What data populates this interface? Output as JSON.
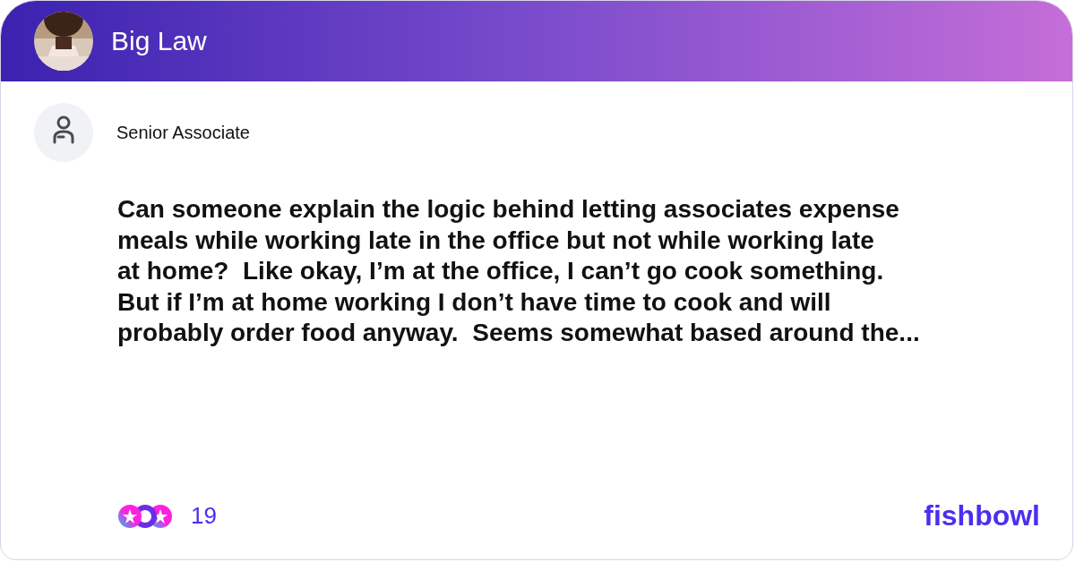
{
  "header": {
    "community": "Big Law"
  },
  "post": {
    "author": "Senior Associate",
    "body": "Can someone explain the logic behind letting associates expense\nmeals while working late in the office but not while working late\nat home?  Like okay, I’m at the office, I can’t go cook something.\nBut if I’m at home working I don’t have time to cook and will\nprobably order food anyway.  Seems somewhat based around the...",
    "reactions": "19"
  },
  "brand": "fishbowl"
}
